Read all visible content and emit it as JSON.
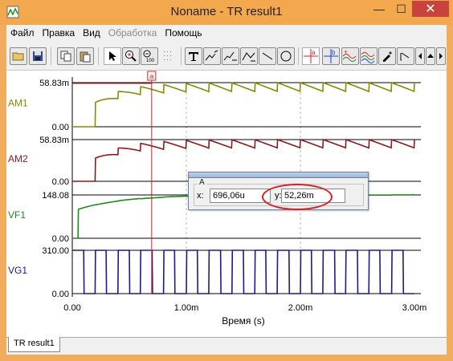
{
  "window": {
    "title": "Noname - TR result1",
    "minimize_glyph": "—",
    "maximize_glyph": "☐",
    "close_glyph": "✕"
  },
  "menu": [
    {
      "label": "Файл",
      "disabled": false
    },
    {
      "label": "Правка",
      "disabled": false
    },
    {
      "label": "Вид",
      "disabled": false
    },
    {
      "label": "Обработка",
      "disabled": true
    },
    {
      "label": "Помощь",
      "disabled": false
    }
  ],
  "toolbar": {
    "icons": [
      "open-folder-icon",
      "save-icon",
      "copy-icon",
      "paste-icon",
      "pointer-icon",
      "zoom-in-icon",
      "zoom-100-icon",
      "grid-icon",
      "text-icon",
      "edit-curve-icon",
      "edit-curve-2-icon",
      "edit-curve-3-icon",
      "line-icon",
      "circle-icon",
      "cursor-a-icon",
      "cursor-b-icon",
      "add-trace-icon",
      "color-trace-icon",
      "marker-icon",
      "step-icon",
      "nav-left-icon",
      "nav-up-icon",
      "nav-right-icon"
    ]
  },
  "chart_data": {
    "type": "line",
    "xlabel": "Время (s)",
    "x_ticks": [
      "0.00",
      "1.00m",
      "2.00m",
      "3.00m"
    ],
    "xlim": [
      0,
      0.003
    ],
    "panels": [
      {
        "name": "AM1",
        "color": "#8a8a00",
        "ymax_label": "58.83m",
        "ymin_label": "0.00",
        "ylim": [
          0,
          0.05883
        ],
        "shape": "rising-sawtooth"
      },
      {
        "name": "AM2",
        "color": "#8b1a1a",
        "ymax_label": "58.83m",
        "ymin_label": "0.00",
        "ylim": [
          0,
          0.05883
        ],
        "shape": "rising-sawtooth"
      },
      {
        "name": "VF1",
        "color": "#1e8a1e",
        "ymax_label": "148.08",
        "ymin_label": "0.00",
        "ylim": [
          0,
          148.08
        ],
        "shape": "rising-smooth"
      },
      {
        "name": "VG1",
        "color": "#1a1a8c",
        "ymax_label": "310.00",
        "ymin_label": "0.00",
        "ylim": [
          0,
          310
        ],
        "shape": "square-wave"
      }
    ],
    "cursor": {
      "label": "a",
      "x": 0.000696,
      "color": "#d81f26"
    }
  },
  "cursor_popup": {
    "legend": "A",
    "x_label": "x:",
    "x_value": "696,06u",
    "y_label": "y:",
    "y_value": "52,26m"
  },
  "tabs": [
    {
      "label": "TR result1"
    }
  ]
}
